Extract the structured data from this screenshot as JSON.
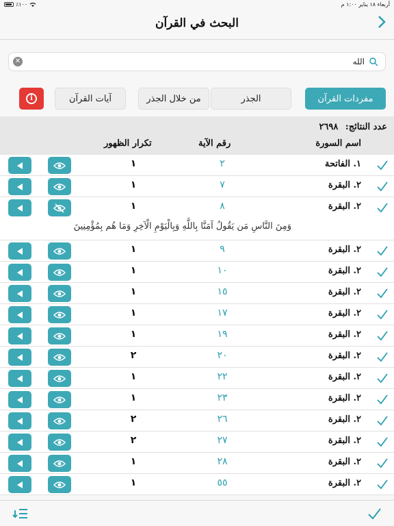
{
  "status": {
    "time": "أربعاء ١٨ يناير ١:٠٠ م",
    "battery": "٪١٠٠"
  },
  "nav": {
    "title": "البحث في القرآن"
  },
  "search": {
    "value": "الله"
  },
  "filters": [
    {
      "label": "مفردات القرآن",
      "active": true
    },
    {
      "label": "الجذر",
      "active": false
    },
    {
      "label": "من خلال الجذر",
      "active": false
    },
    {
      "label": "آيات القرآن",
      "active": false
    }
  ],
  "results": {
    "count_label": "عدد النتائج:",
    "count": "٢٦٩٨",
    "col_surah": "اسم السورة",
    "col_ayah": "رقم الآية",
    "col_repeat": "تكرار الظهور"
  },
  "rows": [
    {
      "surah": "١. الفاتحة",
      "ayah": "٢",
      "repeat": "١"
    },
    {
      "surah": "٢. البقرة",
      "ayah": "٧",
      "repeat": "١"
    },
    {
      "surah": "٢. البقرة",
      "ayah": "٨",
      "repeat": "١",
      "verse": "وَمِنَ النَّاسِ مَن يَقُولُ آمَنَّا بِاللَّهِ وَبِالْيَوْمِ الْآخِرِ وَمَا هُم بِمُؤْمِنِينَ"
    },
    {
      "surah": "٢. البقرة",
      "ayah": "٩",
      "repeat": "١"
    },
    {
      "surah": "٢. البقرة",
      "ayah": "١٠",
      "repeat": "١"
    },
    {
      "surah": "٢. البقرة",
      "ayah": "١٥",
      "repeat": "١"
    },
    {
      "surah": "٢. البقرة",
      "ayah": "١٧",
      "repeat": "١"
    },
    {
      "surah": "٢. البقرة",
      "ayah": "١٩",
      "repeat": "١"
    },
    {
      "surah": "٢. البقرة",
      "ayah": "٢٠",
      "repeat": "٢"
    },
    {
      "surah": "٢. البقرة",
      "ayah": "٢٢",
      "repeat": "١"
    },
    {
      "surah": "٢. البقرة",
      "ayah": "٢٣",
      "repeat": "١"
    },
    {
      "surah": "٢. البقرة",
      "ayah": "٢٦",
      "repeat": "٢"
    },
    {
      "surah": "٢. البقرة",
      "ayah": "٢٧",
      "repeat": "٢"
    },
    {
      "surah": "٢. البقرة",
      "ayah": "٢٨",
      "repeat": "١"
    },
    {
      "surah": "٢. البقرة",
      "ayah": "٥٥",
      "repeat": "١"
    }
  ],
  "colors": {
    "accent": "#3ea9b6",
    "info": "#e53935"
  },
  "icons": {
    "back": "chevron-right-icon",
    "search": "magnifier-icon",
    "clear": "clear-icon",
    "check": "checkmark-icon",
    "eye": "eye-icon",
    "eye_off": "eye-off-icon",
    "play": "play-icon",
    "sort": "sort-list-icon"
  }
}
